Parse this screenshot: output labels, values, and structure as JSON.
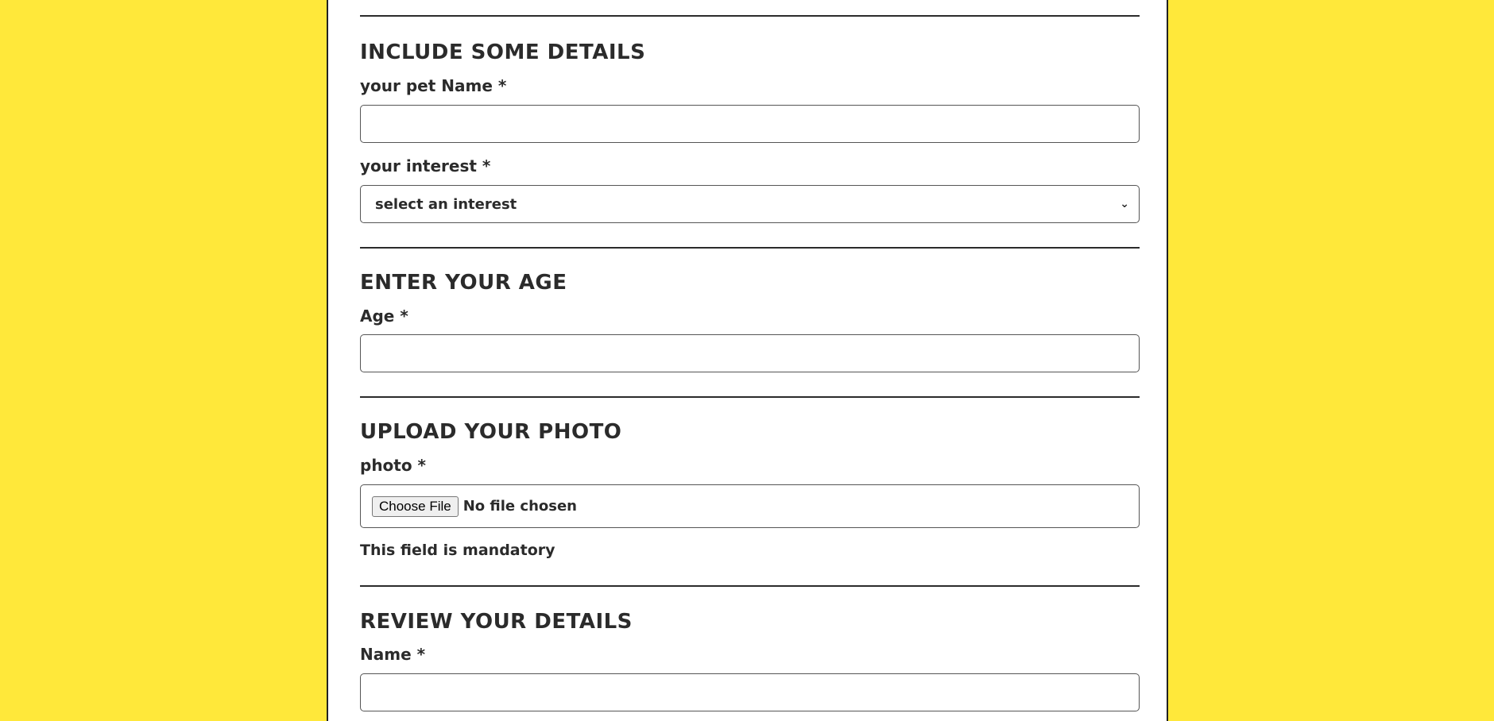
{
  "sections": {
    "details": {
      "title": "INCLUDE SOME DETAILS",
      "pet_name_label": "your pet Name *",
      "pet_name_value": "",
      "interest_label": "your interest *",
      "interest_selected": "select an interest"
    },
    "age": {
      "title": "ENTER YOUR AGE",
      "age_label": "Age *",
      "age_value": ""
    },
    "photo": {
      "title": "UPLOAD YOUR PHOTO",
      "photo_label": "photo *",
      "choose_file_label": "Choose File",
      "file_status": "No file chosen",
      "helper": "This field is mandatory"
    },
    "review": {
      "title": "REVIEW YOUR DETAILS",
      "name_label": "Name *",
      "name_value": ""
    }
  },
  "icons": {
    "select_chevron": "chevron-down-icon"
  },
  "colors": {
    "page_background": "#ffe83a",
    "panel_background": "#ffffff",
    "text": "#2b2b2b"
  }
}
